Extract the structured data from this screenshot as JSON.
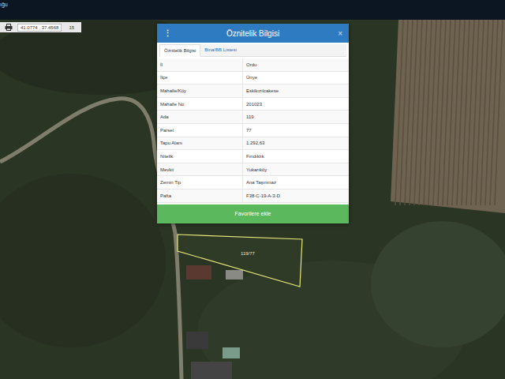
{
  "top_bar": {
    "title": "ığu"
  },
  "toolbar": {
    "print_icon": "print",
    "latitude": "41.0774",
    "longitude": "37.4568",
    "zoom": "15"
  },
  "dialog": {
    "title": "Öznitelik Bilgisi",
    "menu_icon": "⋮",
    "close": "×",
    "tabs": [
      {
        "label": "Öznitelik Bilgisi",
        "selected": true
      },
      {
        "label": "Bina/BB Listesi",
        "selected": false
      }
    ],
    "rows": [
      {
        "label": "İl",
        "value": "Ordu"
      },
      {
        "label": "İlçe",
        "value": "Ünye"
      },
      {
        "label": "Mahalle/Köy",
        "value": "Eskikızılcakese"
      },
      {
        "label": "Mahalle No",
        "value": "201023"
      },
      {
        "label": "Ada",
        "value": "119"
      },
      {
        "label": "Parsel",
        "value": "77"
      },
      {
        "label": "Tapu Alanı",
        "value": "1.292,63"
      },
      {
        "label": "Nitelik",
        "value": "Fındıklık"
      },
      {
        "label": "Mevkii",
        "value": "Yukarıköy"
      },
      {
        "label": "Zemin Tip",
        "value": "Ana Taşınmaz"
      },
      {
        "label": "Pafta",
        "value": "F38-C-19-A-3-D"
      }
    ],
    "button": "Favorilere ekle"
  },
  "parcel": {
    "label": "119/77"
  }
}
